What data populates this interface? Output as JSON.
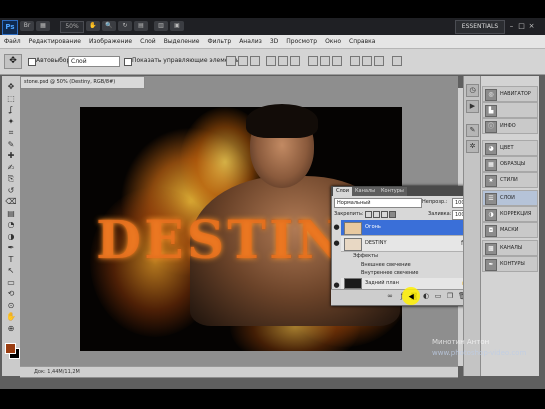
{
  "app": {
    "logo": "Ps",
    "workspace": "ESSENTIALS",
    "zoom": "50%"
  },
  "menu": [
    "Файл",
    "Редактирование",
    "Изображение",
    "Слой",
    "Выделение",
    "Фильтр",
    "Анализ",
    "3D",
    "Просмотр",
    "Окно",
    "Справка"
  ],
  "options": {
    "autoselect_label": "Автовыбор:",
    "autoselect_value": "Слой",
    "transform_label": "Показать управляющие элементы"
  },
  "document": {
    "tab": "stone.psd @ 50% (Destiny, RGB/8#)",
    "headline": "DESTINY",
    "status": "Док: 1,44M/11,2M"
  },
  "layers_panel": {
    "tabs": [
      "Слои",
      "Каналы",
      "Контуры"
    ],
    "blend_mode": "Нормальный",
    "opacity_label": "Непрозр.:",
    "opacity": "100%",
    "lock_label": "Закрепить:",
    "fill_label": "Заливка:",
    "fill": "100%",
    "layers": [
      {
        "name": "Огонь",
        "selected": true,
        "thumb": "#e8c9a0"
      },
      {
        "name": "DESTINY",
        "selected": false,
        "thumb": "#e8d8c4"
      },
      {
        "name": "Задний план",
        "selected": false,
        "thumb": "#1a1a1a"
      }
    ],
    "effects_label": "Эффекты",
    "effects": [
      "Внешнее свечение",
      "Внутреннее свечение"
    ]
  },
  "dock": {
    "items": [
      "НАВИГАТОР",
      "ГИСТОГРАММА",
      "ИНФО",
      "ЦВЕТ",
      "ОБРАЗЦЫ",
      "СТИЛИ",
      "СЛОИ",
      "КОРРЕКЦИЯ",
      "МАСКИ",
      "КАНАЛЫ",
      "КОНТУРЫ"
    ],
    "active": "СЛОИ"
  },
  "watermark": {
    "author": "Минотин Антон",
    "site": "www.photoshop-video.com"
  },
  "colors": {
    "foreground": "#9b3e12",
    "background": "#000000",
    "selection": "#3a6fd8"
  },
  "tools": [
    "move-tool",
    "marquee-tool",
    "lasso-tool",
    "magic-wand-tool",
    "crop-tool",
    "eyedropper-tool",
    "healing-tool",
    "brush-tool",
    "clone-stamp-tool",
    "history-brush-tool",
    "eraser-tool",
    "gradient-tool",
    "blur-tool",
    "dodge-tool",
    "pen-tool",
    "type-tool",
    "path-selection-tool",
    "shape-tool",
    "3d-rotate-tool",
    "3d-orbit-tool",
    "hand-tool",
    "zoom-tool"
  ]
}
